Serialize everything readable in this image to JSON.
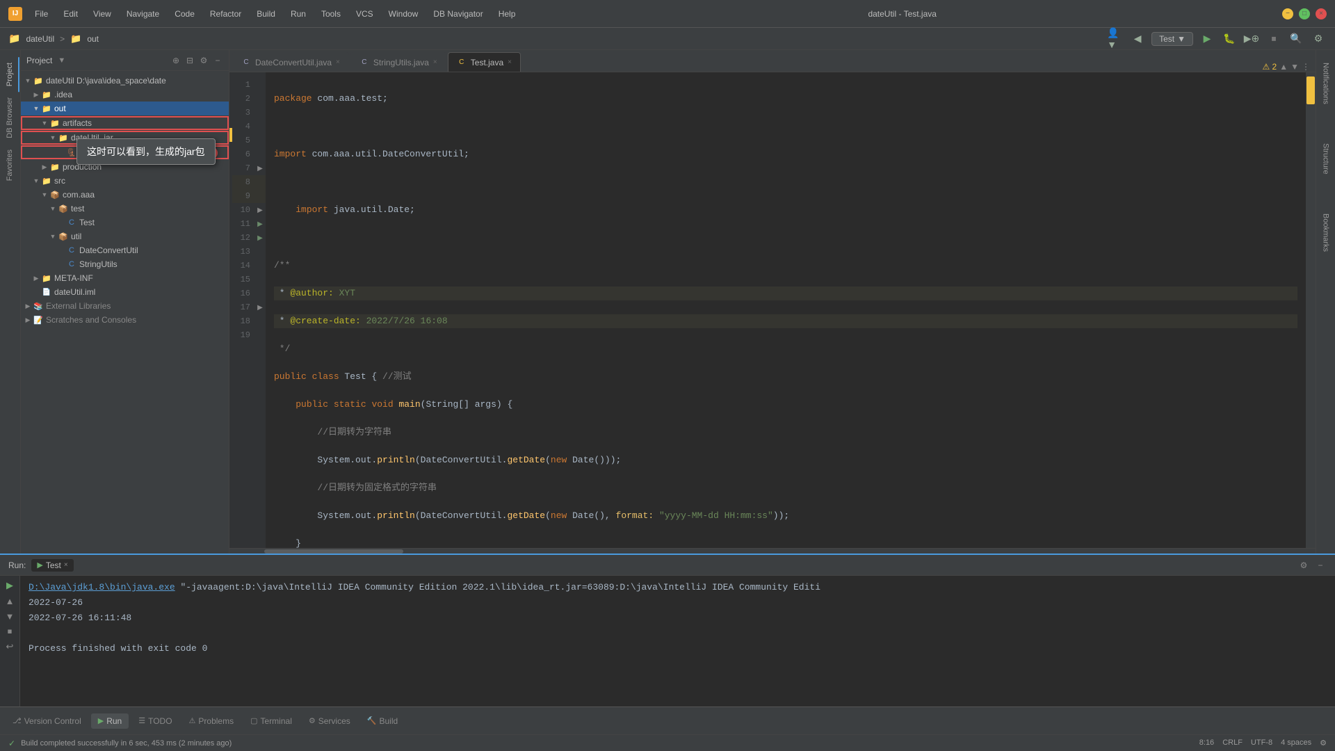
{
  "app": {
    "title": "dateUtil - Test.java",
    "project_name": "dateUtil",
    "project_path": "out"
  },
  "title_bar": {
    "menu_items": [
      "File",
      "Edit",
      "View",
      "Navigate",
      "Code",
      "Refactor",
      "Build",
      "Run",
      "Tools",
      "VCS",
      "Window",
      "DB Navigator",
      "Help"
    ]
  },
  "toolbar": {
    "run_config": "Test",
    "icons": [
      "back",
      "forward",
      "run",
      "debug",
      "run-coverage",
      "stop",
      "search",
      "settings"
    ]
  },
  "project_panel": {
    "title": "Project",
    "tree": [
      {
        "id": "dateUtil",
        "label": "dateUtil D:\\java\\idea_space\\date",
        "type": "folder",
        "indent": 0,
        "expanded": true
      },
      {
        "id": "idea",
        "label": ".idea",
        "type": "folder",
        "indent": 1,
        "expanded": false
      },
      {
        "id": "out",
        "label": "out",
        "type": "folder",
        "indent": 1,
        "expanded": true,
        "selected": true
      },
      {
        "id": "artifacts",
        "label": "artifacts",
        "type": "folder",
        "indent": 2,
        "expanded": true,
        "red_outline": true
      },
      {
        "id": "dateUtil_jar",
        "label": "dateUtil_jar",
        "type": "folder",
        "indent": 3,
        "expanded": true,
        "red_outline": true
      },
      {
        "id": "dateUtil_jar_file",
        "label": "dateUtil.jar",
        "type": "jar",
        "indent": 4,
        "red_outline": true
      },
      {
        "id": "production",
        "label": "production",
        "type": "folder",
        "indent": 2,
        "expanded": false
      },
      {
        "id": "src",
        "label": "src",
        "type": "folder",
        "indent": 1,
        "expanded": true
      },
      {
        "id": "com_aaa",
        "label": "com.aaa",
        "type": "folder",
        "indent": 2,
        "expanded": true
      },
      {
        "id": "test",
        "label": "test",
        "type": "folder",
        "indent": 3,
        "expanded": true
      },
      {
        "id": "Test",
        "label": "Test",
        "type": "java",
        "indent": 4
      },
      {
        "id": "util",
        "label": "util",
        "type": "folder",
        "indent": 3,
        "expanded": true
      },
      {
        "id": "DateConvertUtil",
        "label": "DateConvertUtil",
        "type": "java",
        "indent": 4
      },
      {
        "id": "StringUtils",
        "label": "StringUtils",
        "type": "java",
        "indent": 4
      },
      {
        "id": "META-INF",
        "label": "META-INF",
        "type": "folder",
        "indent": 1,
        "expanded": false
      },
      {
        "id": "dateUtil_iml",
        "label": "dateUtil.iml",
        "type": "file",
        "indent": 1
      },
      {
        "id": "External_Libraries",
        "label": "External Libraries",
        "type": "folder",
        "indent": 0,
        "expanded": false
      },
      {
        "id": "Scratches",
        "label": "Scratches and Consoles",
        "type": "folder",
        "indent": 0,
        "expanded": false
      }
    ]
  },
  "editor": {
    "tabs": [
      {
        "label": "DateConvertUtil.java",
        "type": "java",
        "active": false
      },
      {
        "label": "StringUtils.java",
        "type": "util",
        "active": false
      },
      {
        "label": "Test.java",
        "type": "java",
        "active": true
      }
    ],
    "warning_count": "2",
    "lines": [
      {
        "num": 1,
        "content": "package com.aaa.test;",
        "tokens": [
          {
            "text": "package ",
            "cls": "kw"
          },
          {
            "text": "com.aaa.test;",
            "cls": "type"
          }
        ]
      },
      {
        "num": 2,
        "content": "",
        "tokens": []
      },
      {
        "num": 3,
        "content": "import com.aaa.util.DateConvertUtil;",
        "tokens": [
          {
            "text": "import ",
            "cls": "kw"
          },
          {
            "text": "com.aaa.util.DateConvertUtil;",
            "cls": "type"
          }
        ]
      },
      {
        "num": 4,
        "content": "",
        "tokens": []
      },
      {
        "num": 5,
        "content": "    import java.util.Date;",
        "tokens": [
          {
            "text": "    "
          },
          {
            "text": "import ",
            "cls": "kw"
          },
          {
            "text": "java.util.Date;",
            "cls": "type"
          }
        ]
      },
      {
        "num": 6,
        "content": "",
        "tokens": []
      },
      {
        "num": 7,
        "content": "/**",
        "tokens": [
          {
            "text": "/**",
            "cls": "comment"
          }
        ]
      },
      {
        "num": 8,
        "content": " * @author: XYT",
        "tokens": [
          {
            "text": " * "
          },
          {
            "text": "@author:",
            "cls": "annotation"
          },
          {
            "text": " XYT",
            "cls": "annotation-val"
          }
        ]
      },
      {
        "num": 9,
        "content": " * @create-date: 2022/7/26 16:08",
        "tokens": [
          {
            "text": " * "
          },
          {
            "text": "@create-date:",
            "cls": "annotation"
          },
          {
            "text": " 2022/7/26 16:08",
            "cls": "annotation-val"
          }
        ]
      },
      {
        "num": 10,
        "content": " */",
        "tokens": [
          {
            "text": " */",
            "cls": "comment"
          }
        ]
      },
      {
        "num": 11,
        "content": "public class Test { //测试",
        "tokens": [
          {
            "text": "public ",
            "cls": "kw"
          },
          {
            "text": "class ",
            "cls": "kw"
          },
          {
            "text": "Test"
          },
          {
            "text": " { "
          },
          {
            "text": "//测试",
            "cls": "comment"
          }
        ]
      },
      {
        "num": 12,
        "content": "    public static void main(String[] args) {",
        "tokens": [
          {
            "text": "    "
          },
          {
            "text": "public ",
            "cls": "kw"
          },
          {
            "text": "static ",
            "cls": "kw"
          },
          {
            "text": "void ",
            "cls": "kw"
          },
          {
            "text": "main",
            "cls": "method"
          },
          {
            "text": "("
          },
          {
            "text": "String",
            "cls": "type"
          },
          {
            "text": "[] args) {"
          }
        ]
      },
      {
        "num": 13,
        "content": "        //日期转为字符串",
        "tokens": [
          {
            "text": "        "
          },
          {
            "text": "//日期转为字符串",
            "cls": "chinese-comment"
          }
        ]
      },
      {
        "num": 14,
        "content": "        System.out.println(DateConvertUtil.getDate(new Date()));",
        "tokens": [
          {
            "text": "        System.out."
          },
          {
            "text": "println",
            "cls": "method"
          },
          {
            "text": "(DateConvertUtil."
          },
          {
            "text": "getDate",
            "cls": "method"
          },
          {
            "text": "("
          },
          {
            "text": "new ",
            "cls": "kw"
          },
          {
            "text": "Date"
          },
          {
            "text": "()));"
          }
        ]
      },
      {
        "num": 15,
        "content": "        //日期转为固定格式的字符串",
        "tokens": [
          {
            "text": "        "
          },
          {
            "text": "//日期转为固定格式的字符串",
            "cls": "chinese-comment"
          }
        ]
      },
      {
        "num": 16,
        "content": "        System.out.println(DateConvertUtil.getDate(new Date(), format: \"yyyy-MM-dd HH:mm:ss\"));",
        "tokens": [
          {
            "text": "        System.out."
          },
          {
            "text": "println",
            "cls": "method"
          },
          {
            "text": "(DateConvertUtil."
          },
          {
            "text": "getDate",
            "cls": "method"
          },
          {
            "text": "("
          },
          {
            "text": "new ",
            "cls": "kw"
          },
          {
            "text": "Date"
          },
          {
            "text": "(), "
          },
          {
            "text": "format:",
            "cls": "param"
          },
          {
            "text": " "
          },
          {
            "text": "\"yyyy-MM-dd HH:mm:ss\"",
            "cls": "str"
          },
          {
            "text": "));"
          }
        ]
      },
      {
        "num": 17,
        "content": "    }",
        "tokens": [
          {
            "text": "    }"
          }
        ]
      },
      {
        "num": 18,
        "content": "}",
        "tokens": [
          {
            "text": "}"
          }
        ]
      },
      {
        "num": 19,
        "content": "",
        "tokens": []
      }
    ]
  },
  "tooltip": {
    "text": "这时可以看到，生成的jar包"
  },
  "red_badge": {
    "number": "1"
  },
  "bottom_panel": {
    "run_label": "Run:",
    "run_tab": "Test",
    "console_lines": [
      {
        "type": "cmd",
        "text": "D:\\Java\\jdk1.8\\bin\\java.exe",
        "rest": " \"-javaagent:D:\\java\\IntelliJ IDEA Community Edition 2022.1\\lib\\idea_rt.jar=63089:D:\\java\\IntelliJ IDEA Community Editi"
      },
      {
        "type": "normal",
        "text": "2022-07-26"
      },
      {
        "type": "normal",
        "text": "2022-07-26 16:11:48"
      },
      {
        "type": "empty",
        "text": ""
      },
      {
        "type": "normal",
        "text": "Process finished with exit code 0"
      }
    ]
  },
  "bottom_tabs": [
    {
      "label": "Version Control",
      "icon": "⎇",
      "active": false
    },
    {
      "label": "Run",
      "icon": "▶",
      "active": true
    },
    {
      "label": "TODO",
      "icon": "☰",
      "active": false
    },
    {
      "label": "Problems",
      "icon": "⚠",
      "active": false
    },
    {
      "label": "Terminal",
      "icon": "▢",
      "active": false
    },
    {
      "label": "Services",
      "icon": "⚙",
      "active": false
    },
    {
      "label": "Build",
      "icon": "🔨",
      "active": false
    }
  ],
  "status_bar": {
    "message": "Build completed successfully in 6 sec, 453 ms (2 minutes ago)",
    "right_items": [
      "8:16",
      "CRLF",
      "UTF-8",
      "4 spaces",
      "⚙️"
    ]
  },
  "sidebar_tabs": {
    "left": [
      "Project",
      "DB Browser",
      "Favorites"
    ],
    "right": [
      "Notifications",
      "Structure",
      "Bookmarks"
    ]
  }
}
